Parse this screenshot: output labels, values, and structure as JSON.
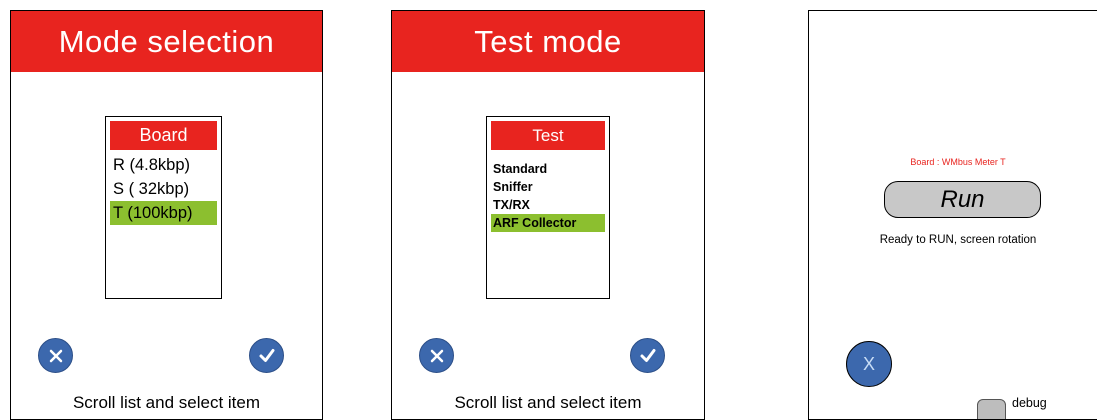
{
  "mode_selection": {
    "title": "Mode selection",
    "list_header": "Board",
    "items": [
      "R (4.8kbp)",
      "S ( 32kbp)",
      "T (100kbp)"
    ],
    "selected_index": 2,
    "footer": "Scroll list and select item",
    "cancel_icon": "x-icon",
    "confirm_icon": "checkmark-icon"
  },
  "test_mode": {
    "title": "Test mode",
    "list_header": "Test",
    "items": [
      "Standard",
      "Sniffer",
      "TX/RX",
      "ARF Collector"
    ],
    "selected_index": 3,
    "footer": "Scroll list and select item",
    "cancel_icon": "x-icon",
    "confirm_icon": "checkmark-icon"
  },
  "run_screen": {
    "board_label": "Board : WMbus Meter T",
    "run_label": "Run",
    "status": "Ready to RUN, screen rotation",
    "cancel_label": "X",
    "debug_label": "debug",
    "debug_checked": false
  },
  "colors": {
    "header_red": "#e8241f",
    "selected_green": "#8cbf2f",
    "button_blue": "#3c68ad",
    "run_gray": "#c8c8c8"
  }
}
